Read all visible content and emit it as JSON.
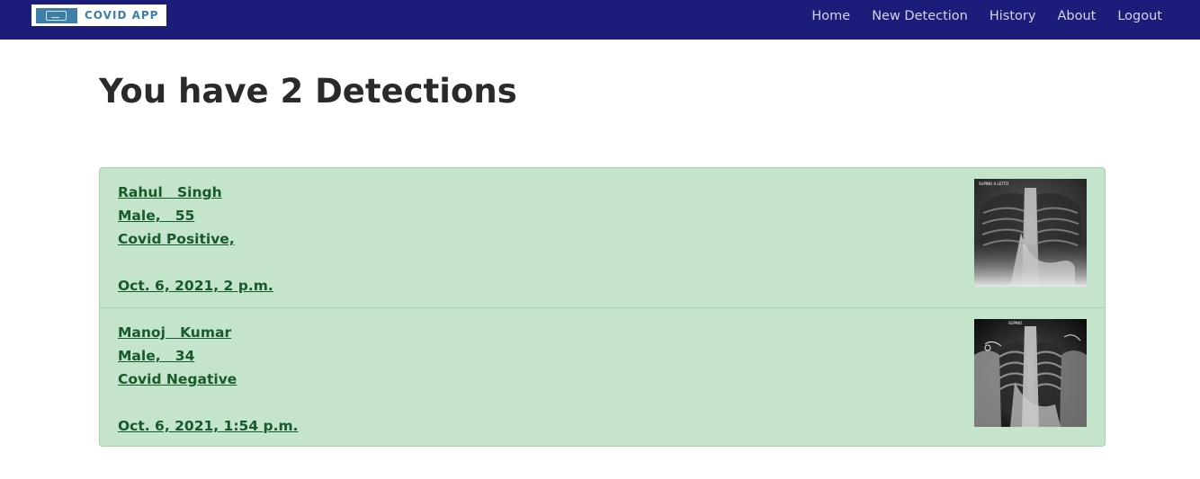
{
  "app": {
    "logo_text": "COVID APP"
  },
  "nav": {
    "items": [
      {
        "label": "Home"
      },
      {
        "label": "New Detection"
      },
      {
        "label": "History"
      },
      {
        "label": "About"
      },
      {
        "label": "Logout"
      }
    ]
  },
  "main": {
    "title": "You have 2 Detections"
  },
  "detections": [
    {
      "name": "Rahul   Singh",
      "gender_age": "Male,   55",
      "result": "Covid Positive,",
      "datetime": "Oct. 6, 2021, 2 p.m.",
      "image_caption": "SUPINO A LETTO"
    },
    {
      "name": "Manoj   Kumar",
      "gender_age": "Male,   34",
      "result": "Covid Negative",
      "datetime": "Oct. 6, 2021, 1:54 p.m.",
      "image_caption": "SUPINO"
    }
  ],
  "colors": {
    "navbar": "#1c1c7b",
    "list_bg": "#c4e5cb",
    "link_text": "#175a2c",
    "logo_accent": "#3e7fa8"
  }
}
